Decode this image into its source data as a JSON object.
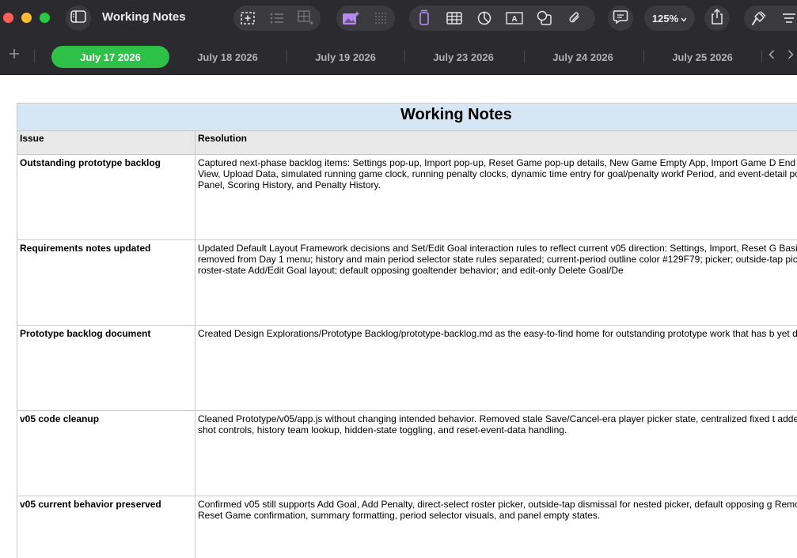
{
  "window": {
    "title": "Working Notes",
    "zoom": "125%",
    "toolbar": {
      "sidebar_icon": "sidebar-icon",
      "left_group_icons": [
        "add-section-icon",
        "list-icon",
        "table-add-icon"
      ],
      "media_group_icons": [
        "media-sparkle-icon",
        "grid-icon"
      ],
      "insert_group_icons": [
        "text-cursor-icon",
        "table-icon",
        "chart-icon",
        "text-box-icon",
        "shapes-icon",
        "attachment-icon"
      ],
      "comment_icon": "comment-icon",
      "share_icon": "share-icon",
      "format_icon": "paintbrush-icon",
      "organize_icon": "organize-icon"
    }
  },
  "tabs": [
    {
      "label": "July 17 2026",
      "active": true
    },
    {
      "label": "July 18 2026",
      "active": false
    },
    {
      "label": "July 19 2026",
      "active": false
    },
    {
      "label": "July 23 2026",
      "active": false
    },
    {
      "label": "July 24 2026",
      "active": false
    },
    {
      "label": "July 25 2026",
      "active": false
    }
  ],
  "colors": {
    "toolbar_bg": "#2b2a2e",
    "active_tab": "#2ec147",
    "title_row_bg": "#d6e6f5",
    "header_row_bg": "#e9e9e9"
  },
  "table": {
    "title": "Working Notes",
    "headers": [
      "Issue",
      "Resolution"
    ],
    "rows": [
      {
        "issue": "Outstanding prototype backlog",
        "resolution": "Captured next-phase backlog items: Settings pop-up, Import pop-up, Reset Game pop-up details, New Game Empty App, Import Game D End Game Boxscore View, Upload Data, simulated running game clock, running penalty clocks, dynamic time entry for goal/penalty workf Period, and event-detail pop-ups from Center Panel, Scoring History, and Penalty History."
      },
      {
        "issue": "Requirements notes updated",
        "resolution": "Updated Default Layout Framework decisions and Set/Edit Goal interaction rules to reflect current v05 direction: Settings, Import, Reset G Basic/Advanced removed from Day 1 menu; history and main period selector state rules separated; current-period outline color #129F79; picker; outside-tap picker dismissal; roster-state Add/Edit Goal layout; default opposing goaltender behavior; and edit-only Delete Goal/De"
      },
      {
        "issue": "Prototype backlog document",
        "resolution": "Created Design Explorations/Prototype Backlog/prototype-backlog.md as the easy-to-find home for outstanding prototype work that has b yet designed or wired."
      },
      {
        "issue": "v05 code cleanup",
        "resolution": "Cleaned Prototype/v05/app.js without changing intended behavior. Removed stale Save/Cancel-era player picker state, centralized fixed t added small helpers for shot controls, history team lookup, hidden-state toggling, and reset-event-data handling."
      },
      {
        "issue": "v05 current behavior preserved",
        "resolution": "Confirmed v05 still supports Add Goal, Add Penalty, direct-select roster picker, outside-tap dismissal for nested picker, default opposing g Remove Shot on Goal, Reset Game confirmation, summary formatting, period selector visuals, and panel empty states."
      }
    ]
  }
}
